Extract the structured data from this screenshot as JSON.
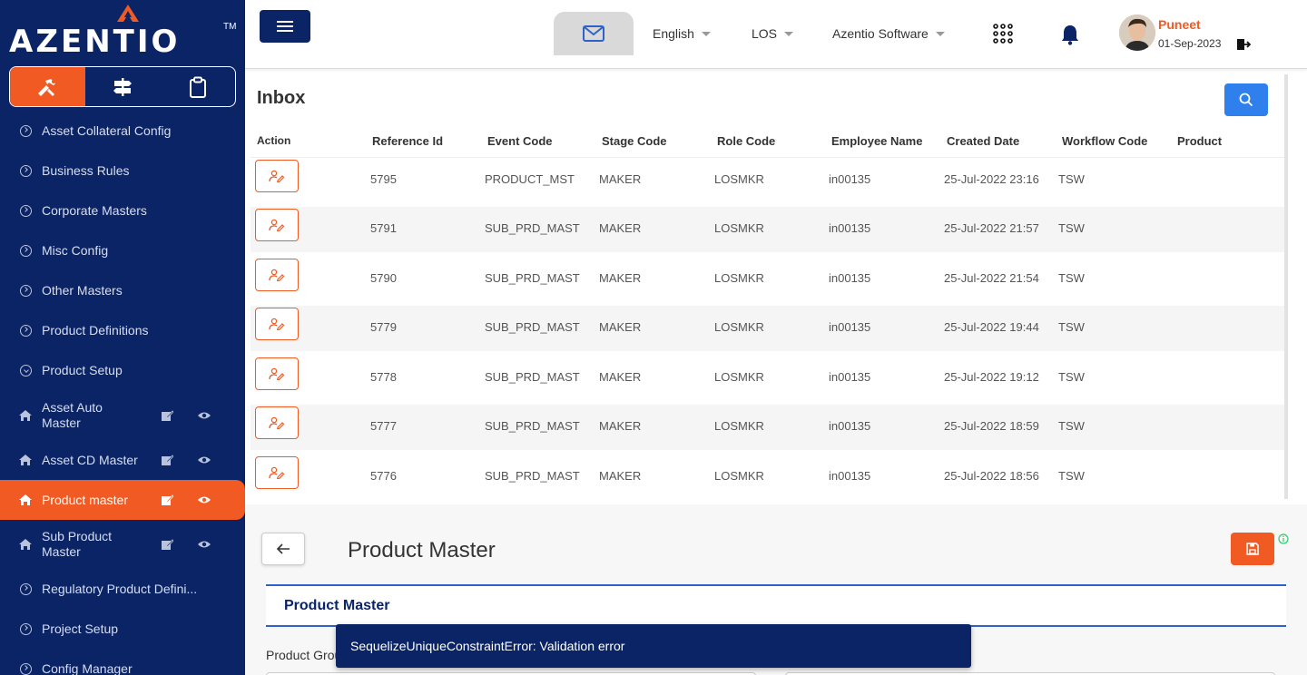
{
  "brand": {
    "name": "AZENTIO",
    "tm": "TM",
    "accent": "#f15a22",
    "navy": "#0b2466"
  },
  "sidebar": {
    "tabs": [
      {
        "icon": "tools-icon",
        "active": true
      },
      {
        "icon": "signpost-icon",
        "active": false
      },
      {
        "icon": "clipboard-icon",
        "active": false
      }
    ],
    "items": [
      {
        "label": "Asset Collateral Config"
      },
      {
        "label": "Business Rules"
      },
      {
        "label": "Corporate Masters"
      },
      {
        "label": "Misc Config"
      },
      {
        "label": "Other Masters"
      },
      {
        "label": "Product Definitions"
      },
      {
        "label": "Product Setup"
      },
      {
        "label": "Asset Auto Master"
      },
      {
        "label": "Asset CD Master"
      },
      {
        "label": "Product master"
      },
      {
        "label": "Sub Product Master"
      },
      {
        "label": "Regulatory Product Defini..."
      },
      {
        "label": "Project Setup"
      },
      {
        "label": "Config Manager"
      }
    ]
  },
  "header": {
    "language": "English",
    "module": "LOS",
    "company": "Azentio Software",
    "user": {
      "name": "Puneet",
      "date": "01-Sep-2023"
    }
  },
  "inbox": {
    "title": "Inbox",
    "columns": [
      "Action",
      "Reference Id",
      "Event Code",
      "Stage Code",
      "Role Code",
      "Employee Name",
      "Created Date",
      "Workflow Code",
      "Product"
    ],
    "rows": [
      {
        "ref": "5795",
        "event": "PRODUCT_MST",
        "stage": "MAKER",
        "role": "LOSMKR",
        "emp": "in00135",
        "created": "25-Jul-2022 23:16",
        "workflow": "TSW",
        "product": ""
      },
      {
        "ref": "5791",
        "event": "SUB_PRD_MAST",
        "stage": "MAKER",
        "role": "LOSMKR",
        "emp": "in00135",
        "created": "25-Jul-2022 21:57",
        "workflow": "TSW",
        "product": ""
      },
      {
        "ref": "5790",
        "event": "SUB_PRD_MAST",
        "stage": "MAKER",
        "role": "LOSMKR",
        "emp": "in00135",
        "created": "25-Jul-2022 21:54",
        "workflow": "TSW",
        "product": ""
      },
      {
        "ref": "5779",
        "event": "SUB_PRD_MAST",
        "stage": "MAKER",
        "role": "LOSMKR",
        "emp": "in00135",
        "created": "25-Jul-2022 19:44",
        "workflow": "TSW",
        "product": ""
      },
      {
        "ref": "5778",
        "event": "SUB_PRD_MAST",
        "stage": "MAKER",
        "role": "LOSMKR",
        "emp": "in00135",
        "created": "25-Jul-2022 19:12",
        "workflow": "TSW",
        "product": ""
      },
      {
        "ref": "5777",
        "event": "SUB_PRD_MAST",
        "stage": "MAKER",
        "role": "LOSMKR",
        "emp": "in00135",
        "created": "25-Jul-2022 18:59",
        "workflow": "TSW",
        "product": ""
      },
      {
        "ref": "5776",
        "event": "SUB_PRD_MAST",
        "stage": "MAKER",
        "role": "LOSMKR",
        "emp": "in00135",
        "created": "25-Jul-2022 18:56",
        "workflow": "TSW",
        "product": ""
      }
    ]
  },
  "product_master": {
    "title": "Product Master",
    "section_title": "Product Master",
    "field_label": "Product Grou"
  },
  "toast": {
    "message": "SequelizeUniqueConstraintError: Validation error"
  }
}
